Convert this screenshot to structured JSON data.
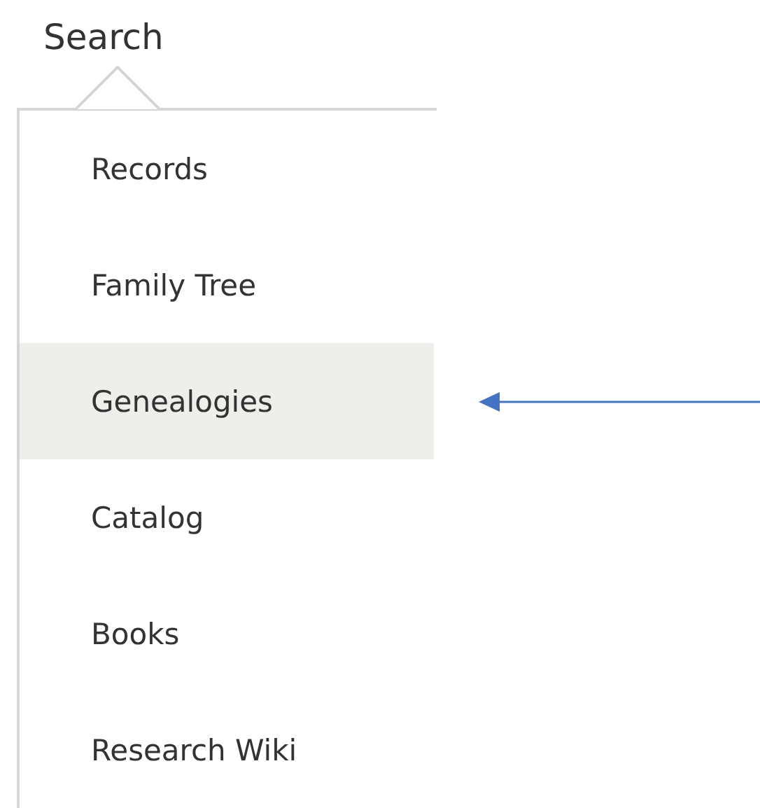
{
  "header": {
    "title": "Search"
  },
  "menu": {
    "items": [
      {
        "label": "Records",
        "selected": false,
        "pointed": false
      },
      {
        "label": "Family Tree",
        "selected": false,
        "pointed": false
      },
      {
        "label": "Genealogies",
        "selected": true,
        "pointed": true
      },
      {
        "label": "Catalog",
        "selected": false,
        "pointed": false
      },
      {
        "label": "Books",
        "selected": false,
        "pointed": false
      },
      {
        "label": "Research Wiki",
        "selected": false,
        "pointed": false
      }
    ]
  }
}
